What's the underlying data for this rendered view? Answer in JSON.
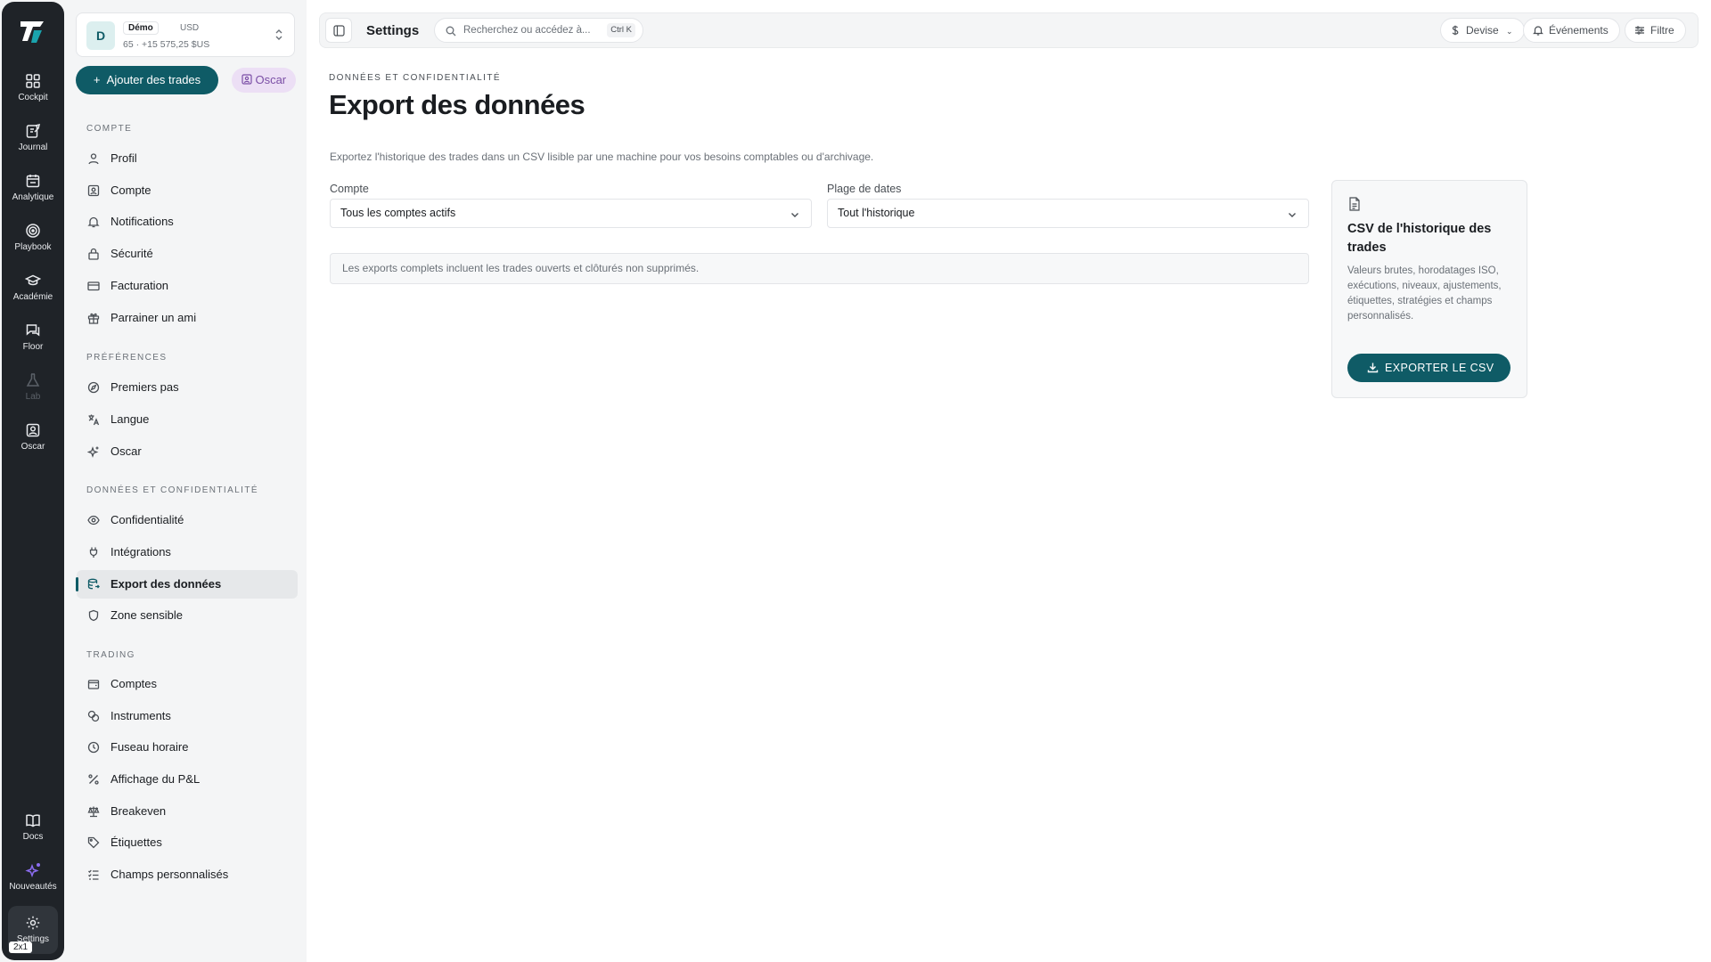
{
  "rail": {
    "items": [
      {
        "label": "Cockpit"
      },
      {
        "label": "Journal"
      },
      {
        "label": "Analytique"
      },
      {
        "label": "Playbook"
      },
      {
        "label": "Académie"
      },
      {
        "label": "Floor"
      },
      {
        "label": "Lab"
      },
      {
        "label": "Oscar"
      }
    ],
    "bottom": [
      {
        "label": "Docs"
      },
      {
        "label": "Nouveautés"
      },
      {
        "label": "Settings"
      }
    ],
    "badge": "2x1"
  },
  "account": {
    "avatar": "D",
    "tag": "Démo",
    "currency": "USD",
    "summary": "65 · +15 575,25 $US"
  },
  "actions": {
    "add_trades": "Ajouter des trades",
    "oscar": "Oscar"
  },
  "sidebar": {
    "sections": [
      {
        "title": "COMPTE",
        "items": [
          "Profil",
          "Compte",
          "Notifications",
          "Sécurité",
          "Facturation",
          "Parrainer un ami"
        ]
      },
      {
        "title": "PRÉFÉRENCES",
        "items": [
          "Premiers pas",
          "Langue",
          "Oscar"
        ]
      },
      {
        "title": "DONNÉES ET CONFIDENTIALITÉ",
        "items": [
          "Confidentialité",
          "Intégrations",
          "Export des données",
          "Zone sensible"
        ]
      },
      {
        "title": "TRADING",
        "items": [
          "Comptes",
          "Instruments",
          "Fuseau horaire",
          "Affichage du P&L",
          "Breakeven",
          "Étiquettes",
          "Champs personnalisés"
        ]
      }
    ]
  },
  "topbar": {
    "title": "Settings",
    "search_placeholder": "Recherchez ou accédez à...",
    "shortcut": "Ctrl K",
    "currency": "Devise",
    "events": "Événements",
    "filter": "Filtre"
  },
  "page": {
    "kicker": "DONNÉES ET CONFIDENTIALITÉ",
    "title": "Export des données",
    "description": "Exportez l'historique des trades dans un CSV lisible par une machine pour vos besoins comptables ou d'archivage.",
    "account_label": "Compte",
    "account_value": "Tous les comptes actifs",
    "range_label": "Plage de dates",
    "range_value": "Tout l'historique",
    "note": "Les exports complets incluent les trades ouverts et clôturés non supprimés."
  },
  "card": {
    "title": "CSV de l'historique des trades",
    "description": "Valeurs brutes, horodatages ISO, exécutions, niveaux, ajustements, étiquettes, stratégies et champs personnalisés.",
    "button": "EXPORTER LE CSV"
  },
  "colors": {
    "accent": "#0f5b66",
    "rail_bg": "#1f2328",
    "oscar_bg": "#ecdff5",
    "oscar_text": "#7b4fa6"
  }
}
